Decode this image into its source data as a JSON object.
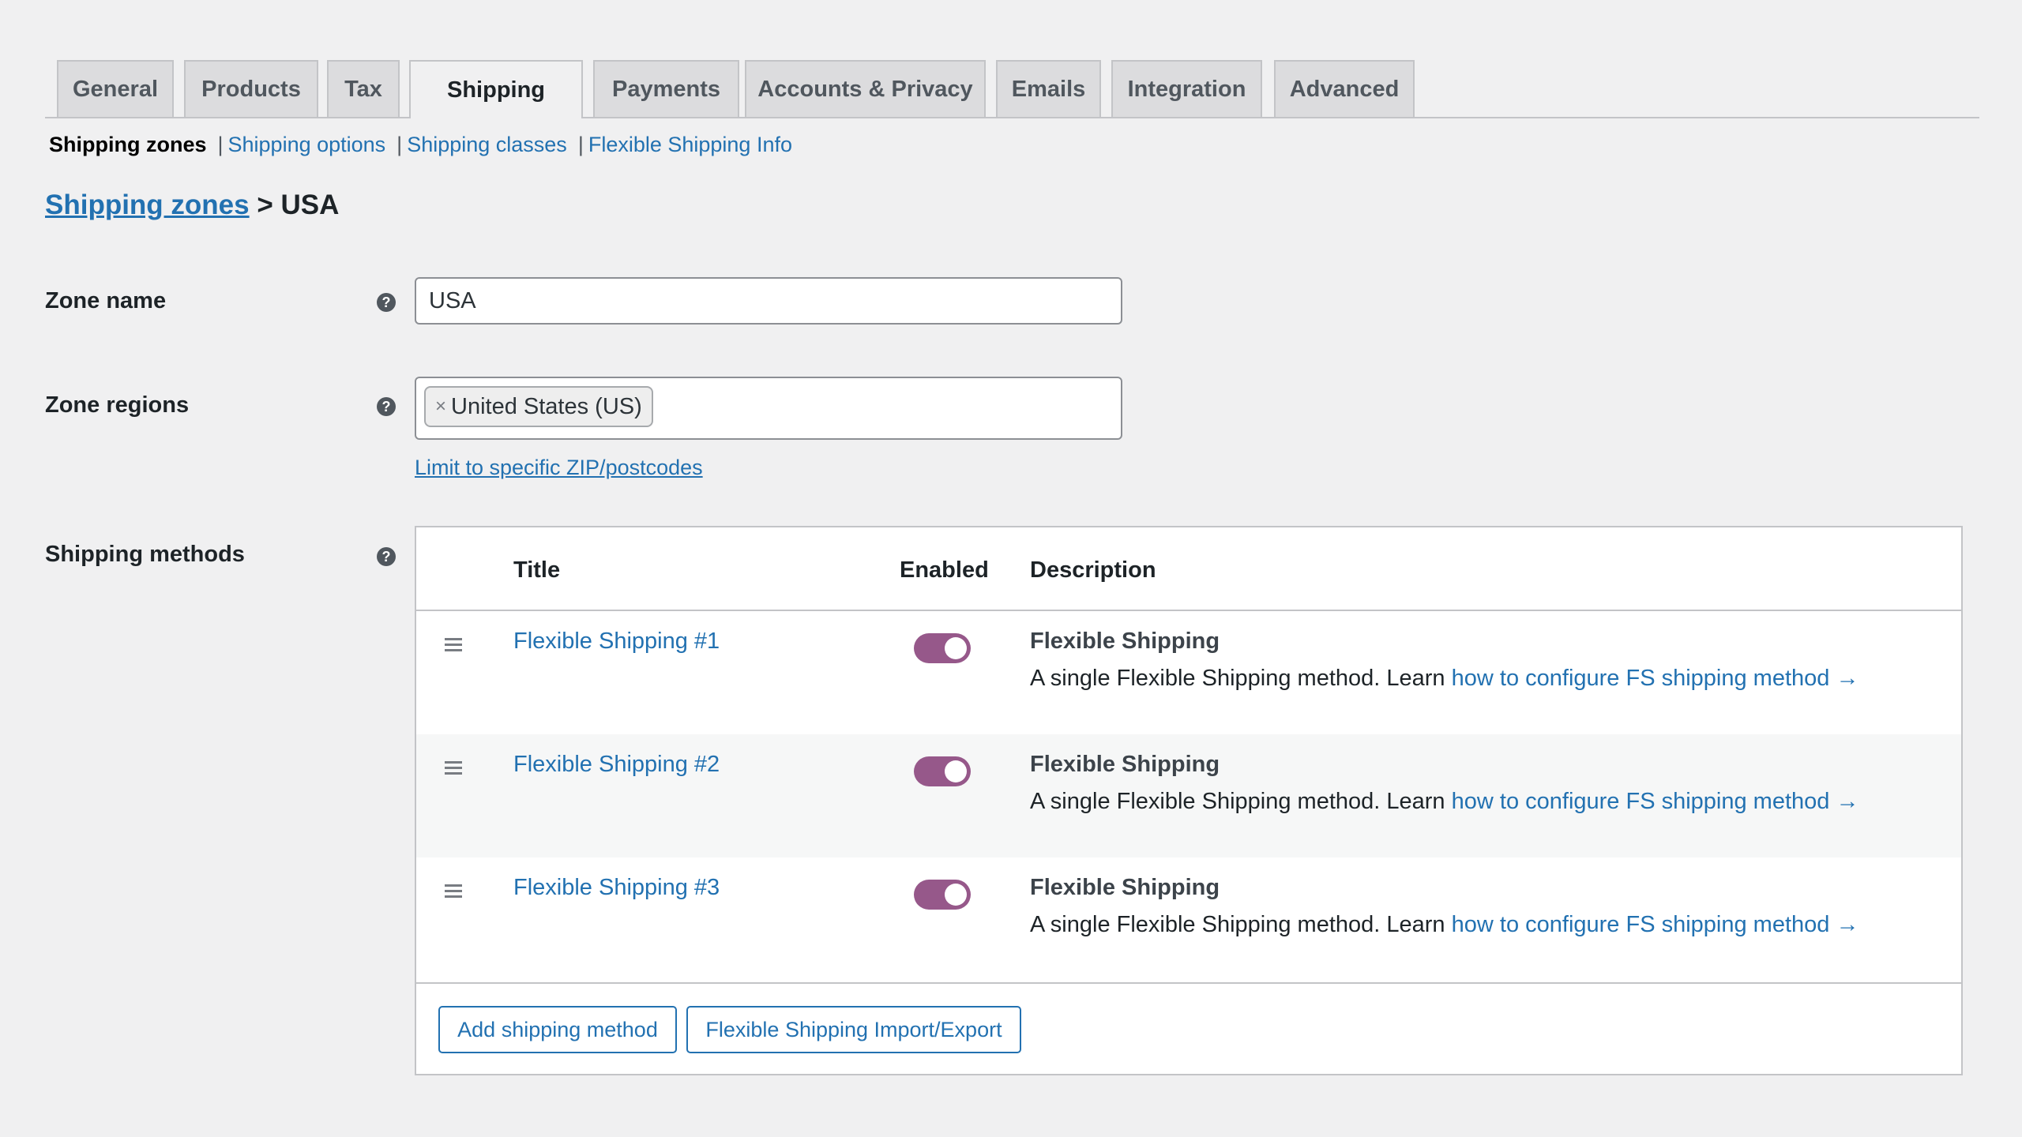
{
  "tabs": [
    "General",
    "Products",
    "Tax",
    "Shipping",
    "Payments",
    "Accounts & Privacy",
    "Emails",
    "Integration",
    "Advanced"
  ],
  "active_tab": "Shipping",
  "subnav": {
    "current": "Shipping zones",
    "links": [
      "Shipping options",
      "Shipping classes",
      "Flexible Shipping Info"
    ],
    "separator": "|"
  },
  "heading": {
    "link": "Shipping zones",
    "rest": "> USA"
  },
  "zone_name": {
    "label": "Zone name",
    "value": "USA",
    "help": "?"
  },
  "zone_regions": {
    "label": "Zone regions",
    "chip": "United States (US)",
    "chip_remove": "×",
    "help": "?",
    "limit_link": "Limit to specific ZIP/postcodes"
  },
  "shipping_methods": {
    "label": "Shipping methods",
    "help": "?",
    "columns": {
      "title": "Title",
      "enabled": "Enabled",
      "description": "Description"
    },
    "rows": [
      {
        "title": "Flexible Shipping #1",
        "enabled": true,
        "desc_title": "Flexible Shipping",
        "desc_text": "A single Flexible Shipping method. Learn ",
        "desc_link": "how to configure FS shipping method →"
      },
      {
        "title": "Flexible Shipping #2",
        "enabled": true,
        "desc_title": "Flexible Shipping",
        "desc_text": "A single Flexible Shipping method. Learn ",
        "desc_link": "how to configure FS shipping method →"
      },
      {
        "title": "Flexible Shipping #3",
        "enabled": true,
        "desc_title": "Flexible Shipping",
        "desc_text": "A single Flexible Shipping method. Learn ",
        "desc_link": "how to configure FS shipping method →"
      }
    ],
    "buttons": {
      "add": "Add shipping method",
      "import_export": "Flexible Shipping Import/Export"
    }
  },
  "colors": {
    "link": "#2271b1",
    "toggle_on": "#96588a",
    "background": "#f0f0f1"
  }
}
